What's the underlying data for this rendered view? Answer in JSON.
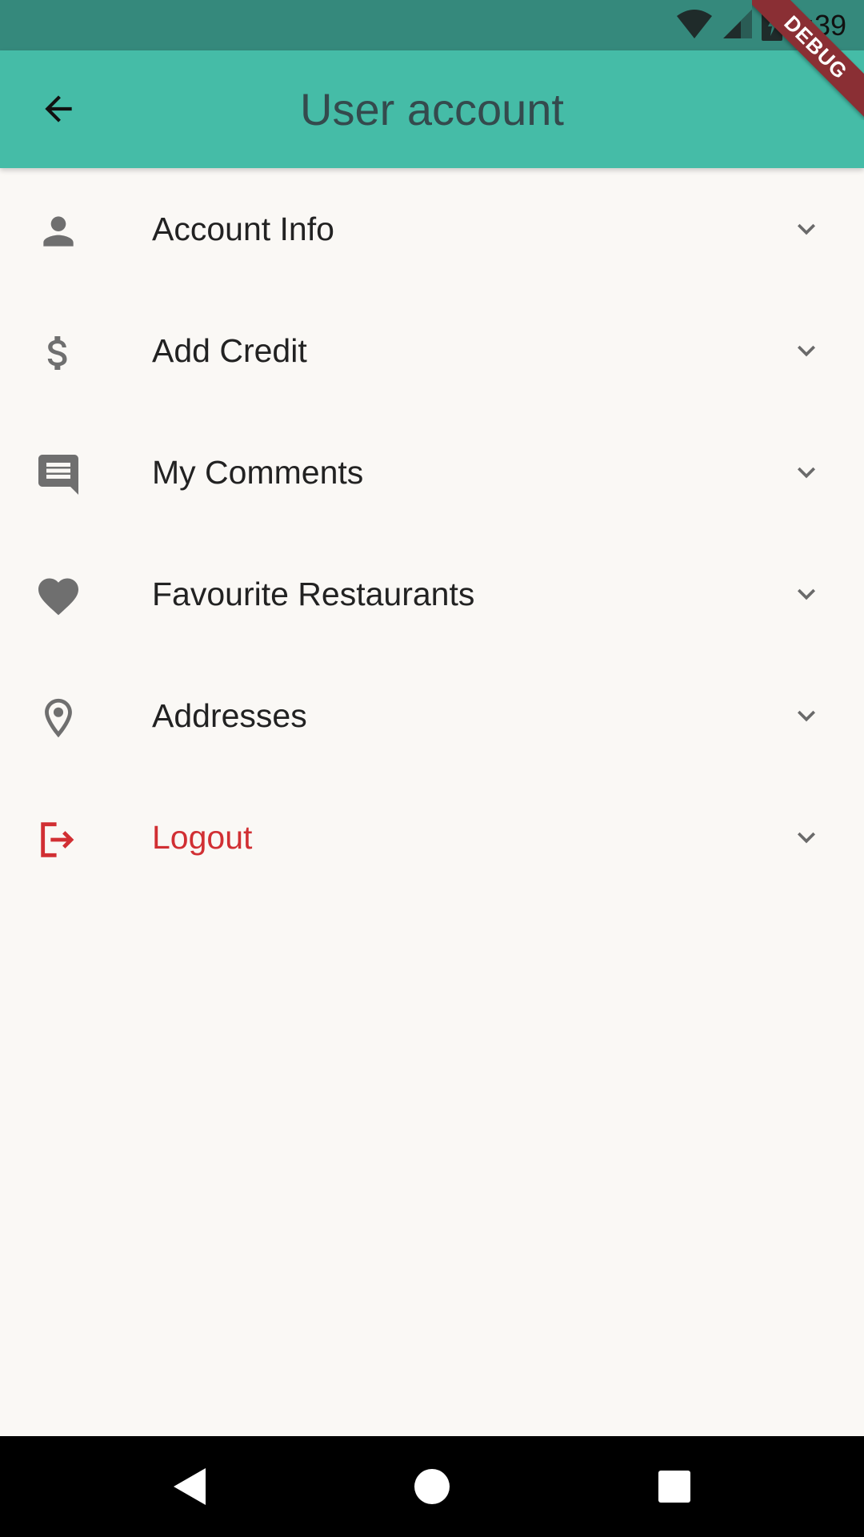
{
  "status_bar": {
    "time": "1:39",
    "debug_label": "DEBUG",
    "icons": [
      "wifi-icon",
      "signal-icon",
      "battery-charging-icon"
    ]
  },
  "app_bar": {
    "title": "User account",
    "back_icon": "arrow-back-icon",
    "color": "#45bca7"
  },
  "menu": {
    "items": [
      {
        "label": "Account Info",
        "icon": "person-icon"
      },
      {
        "label": "Add Credit",
        "icon": "dollar-icon"
      },
      {
        "label": "My Comments",
        "icon": "comment-icon"
      },
      {
        "label": "Favourite Restaurants",
        "icon": "heart-icon"
      },
      {
        "label": "Addresses",
        "icon": "location-pin-icon"
      },
      {
        "label": "Logout",
        "icon": "logout-icon",
        "color": "#d12f33"
      }
    ]
  },
  "nav_bar": {
    "buttons": [
      "back-triangle-icon",
      "home-circle-icon",
      "recents-square-icon"
    ]
  }
}
